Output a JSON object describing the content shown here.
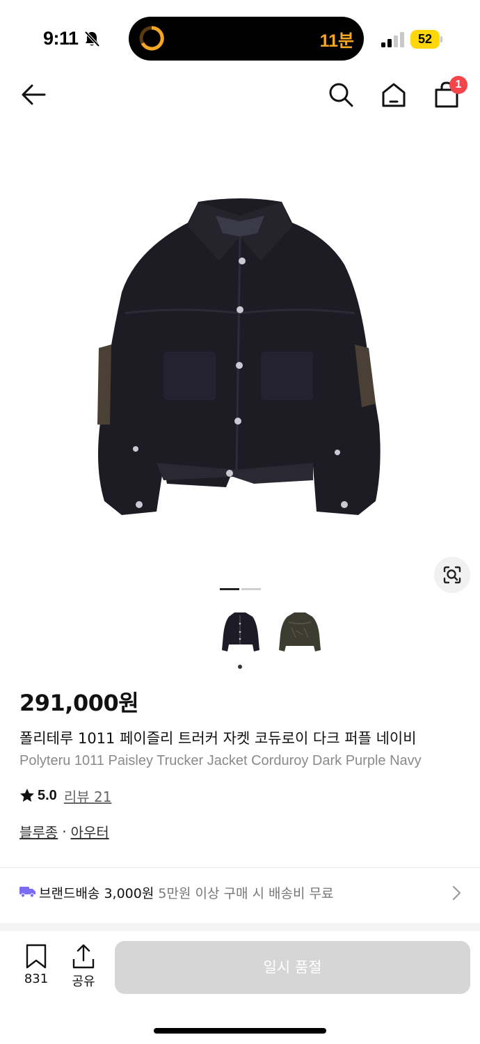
{
  "status_bar": {
    "time": "9:11",
    "island_timer": "11분",
    "battery_level": "52",
    "icons": [
      "bell-muted-icon",
      "timer-ring-icon",
      "signal-icon",
      "battery-icon"
    ]
  },
  "nav": {
    "icons": [
      "arrow-left-icon",
      "search-icon",
      "home-icon",
      "shopping-bag-icon"
    ],
    "cart_count": "1"
  },
  "gallery": {
    "image_count": 2,
    "selected_index": 0,
    "image_search_icon": "camera-lens-search-icon"
  },
  "product": {
    "price": "291,000원",
    "title_ko": "폴리테루 1011 페이즐리 트러커 자켓 코듀로이 다크 퍼플 네이비",
    "title_en": "Polyteru 1011 Paisley Trucker Jacket Corduroy Dark Purple Navy",
    "rating": "5.0",
    "review_label": "리뷰 21",
    "categories": [
      "블루종",
      "아우터"
    ],
    "category_separator": "·"
  },
  "shipping": {
    "label": "브랜드배송 3,000원",
    "note": "5만원 이상 구매 시 배송비 무료"
  },
  "bottom_bar": {
    "bookmark_count": "831",
    "share_label": "공유",
    "cta_label": "일시 품절"
  },
  "colors": {
    "accent_badge": "#f5444a",
    "truck_icon": "#7b6cf6",
    "timer": "#f5a623",
    "battery": "#ffd60a",
    "cta_disabled": "#d6d6d6"
  }
}
